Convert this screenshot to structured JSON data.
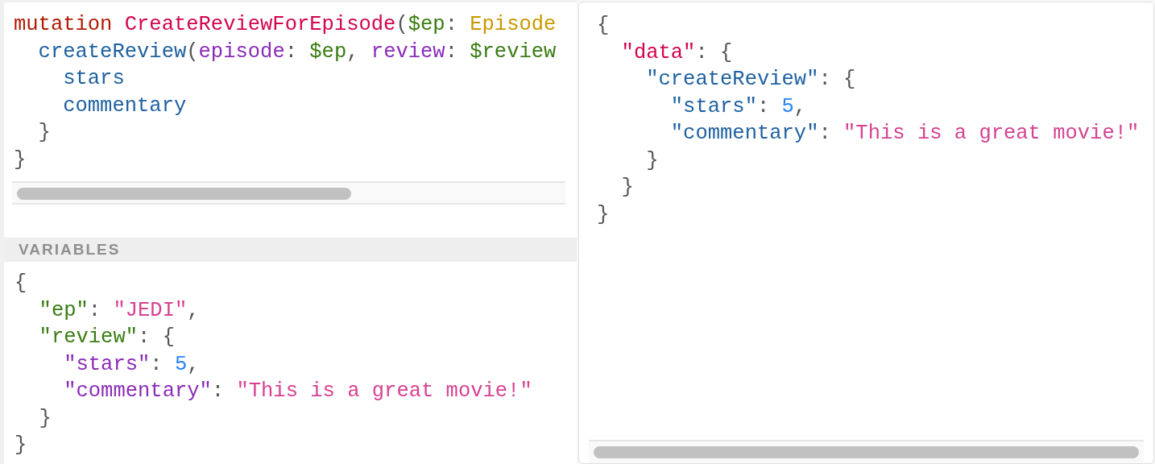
{
  "query_editor": {
    "lines": [
      [
        {
          "text": "mutation ",
          "kind": "keyword"
        },
        {
          "text": "CreateReviewForEpisode",
          "kind": "def"
        },
        {
          "text": "(",
          "kind": "punct"
        },
        {
          "text": "$ep",
          "kind": "variable"
        },
        {
          "text": ": ",
          "kind": "punct"
        },
        {
          "text": "Episode",
          "kind": "type"
        }
      ],
      [
        {
          "text": "  createReview",
          "kind": "property"
        },
        {
          "text": "(",
          "kind": "punct"
        },
        {
          "text": "episode",
          "kind": "attribute"
        },
        {
          "text": ": ",
          "kind": "punct"
        },
        {
          "text": "$ep",
          "kind": "variable"
        },
        {
          "text": ", ",
          "kind": "punct"
        },
        {
          "text": "review",
          "kind": "attribute"
        },
        {
          "text": ": ",
          "kind": "punct"
        },
        {
          "text": "$review",
          "kind": "variable"
        }
      ],
      [
        {
          "text": "    stars",
          "kind": "property"
        }
      ],
      [
        {
          "text": "    commentary",
          "kind": "property"
        }
      ],
      [
        {
          "text": "  }",
          "kind": "punct"
        }
      ],
      [
        {
          "text": "}",
          "kind": "punct"
        }
      ]
    ]
  },
  "variables_panel": {
    "title": "VARIABLES",
    "lines": [
      [
        {
          "text": "{",
          "kind": "punct"
        }
      ],
      [
        {
          "text": "  \"ep\"",
          "kind": "variable"
        },
        {
          "text": ": ",
          "kind": "punct"
        },
        {
          "text": "\"JEDI\"",
          "kind": "string"
        },
        {
          "text": ",",
          "kind": "punct"
        }
      ],
      [
        {
          "text": "  \"review\"",
          "kind": "variable"
        },
        {
          "text": ": {",
          "kind": "punct"
        }
      ],
      [
        {
          "text": "    \"stars\"",
          "kind": "attribute"
        },
        {
          "text": ": ",
          "kind": "punct"
        },
        {
          "text": "5",
          "kind": "number"
        },
        {
          "text": ",",
          "kind": "punct"
        }
      ],
      [
        {
          "text": "    \"commentary\"",
          "kind": "attribute"
        },
        {
          "text": ": ",
          "kind": "punct"
        },
        {
          "text": "\"This is a great movie!\"",
          "kind": "string"
        }
      ],
      [
        {
          "text": "  }",
          "kind": "punct"
        }
      ],
      [
        {
          "text": "}",
          "kind": "punct"
        }
      ]
    ]
  },
  "result_panel": {
    "lines": [
      [
        {
          "text": "{",
          "kind": "punct"
        }
      ],
      [
        {
          "text": "  \"data\"",
          "kind": "def"
        },
        {
          "text": ": {",
          "kind": "punct"
        }
      ],
      [
        {
          "text": "    \"createReview\"",
          "kind": "property"
        },
        {
          "text": ": {",
          "kind": "punct"
        }
      ],
      [
        {
          "text": "      \"stars\"",
          "kind": "property"
        },
        {
          "text": ": ",
          "kind": "punct"
        },
        {
          "text": "5",
          "kind": "number"
        },
        {
          "text": ",",
          "kind": "punct"
        }
      ],
      [
        {
          "text": "      \"commentary\"",
          "kind": "property"
        },
        {
          "text": ": ",
          "kind": "punct"
        },
        {
          "text": "\"This is a great movie!\"",
          "kind": "string"
        }
      ],
      [
        {
          "text": "    }",
          "kind": "punct"
        }
      ],
      [
        {
          "text": "  }",
          "kind": "punct"
        }
      ],
      [
        {
          "text": "}",
          "kind": "punct"
        }
      ]
    ]
  }
}
